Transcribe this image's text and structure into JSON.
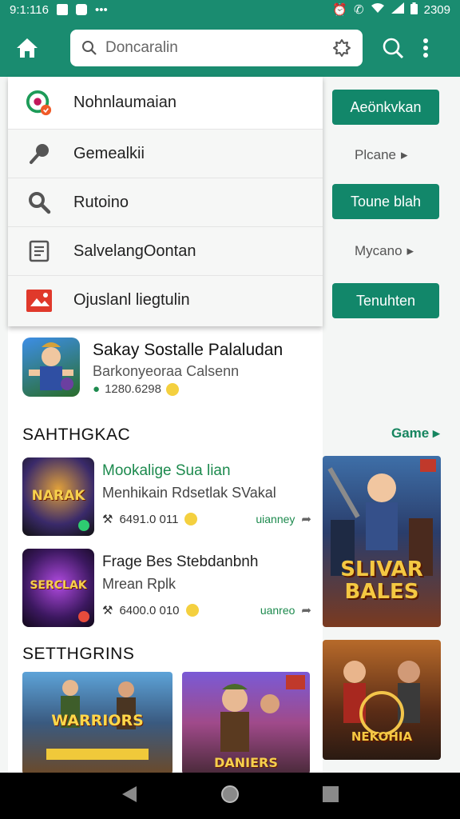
{
  "status": {
    "time": "9:1:116",
    "battery": "2309"
  },
  "appbar": {
    "search_placeholder": "Doncaralin"
  },
  "menu": [
    {
      "label": "Nohnlaumaian",
      "icon": "app-badge-icon"
    },
    {
      "label": "Gemealkii",
      "icon": "pin-icon"
    },
    {
      "label": "Rutoino",
      "icon": "search-icon"
    },
    {
      "label": "SalvelangOontan",
      "icon": "document-icon"
    },
    {
      "label": "Ojuslanl liegtulin",
      "icon": "image-icon"
    }
  ],
  "side": {
    "btn1": "Aeönkvkan",
    "link1": "Plcane",
    "btn2": "Toune blah",
    "link2": "Mycano",
    "btn3": "Tenuhten",
    "game_more": "Game"
  },
  "featured": {
    "title": "Sakay Sostalle Palaludan",
    "subtitle": "Barkonyeoraa Calsenn",
    "meta": "1280.6298"
  },
  "section1": {
    "title": "SAHTHGKAC",
    "items": [
      {
        "title": "Mookalige Sua lian",
        "subtitle": "Menhikain Rdsetlak SVakal",
        "meta": "6491.0 011",
        "tag": "uianney"
      },
      {
        "title": "Frage Bes Stebdanbnh",
        "subtitle": "Mrean Rplk",
        "meta": "6400.0 010",
        "tag": "uanreo"
      }
    ]
  },
  "section2": {
    "title": "SETTHGRINS"
  },
  "posters": {
    "p1": "SLIVAR BALES",
    "p2": "NEKOHIA",
    "thumb1": "NARAK",
    "thumb2": "SERCLAK",
    "banner1": "WARRIORS",
    "banner2": "DANIERS"
  },
  "colors": {
    "primary": "#1a8c70",
    "button": "#12876a"
  }
}
